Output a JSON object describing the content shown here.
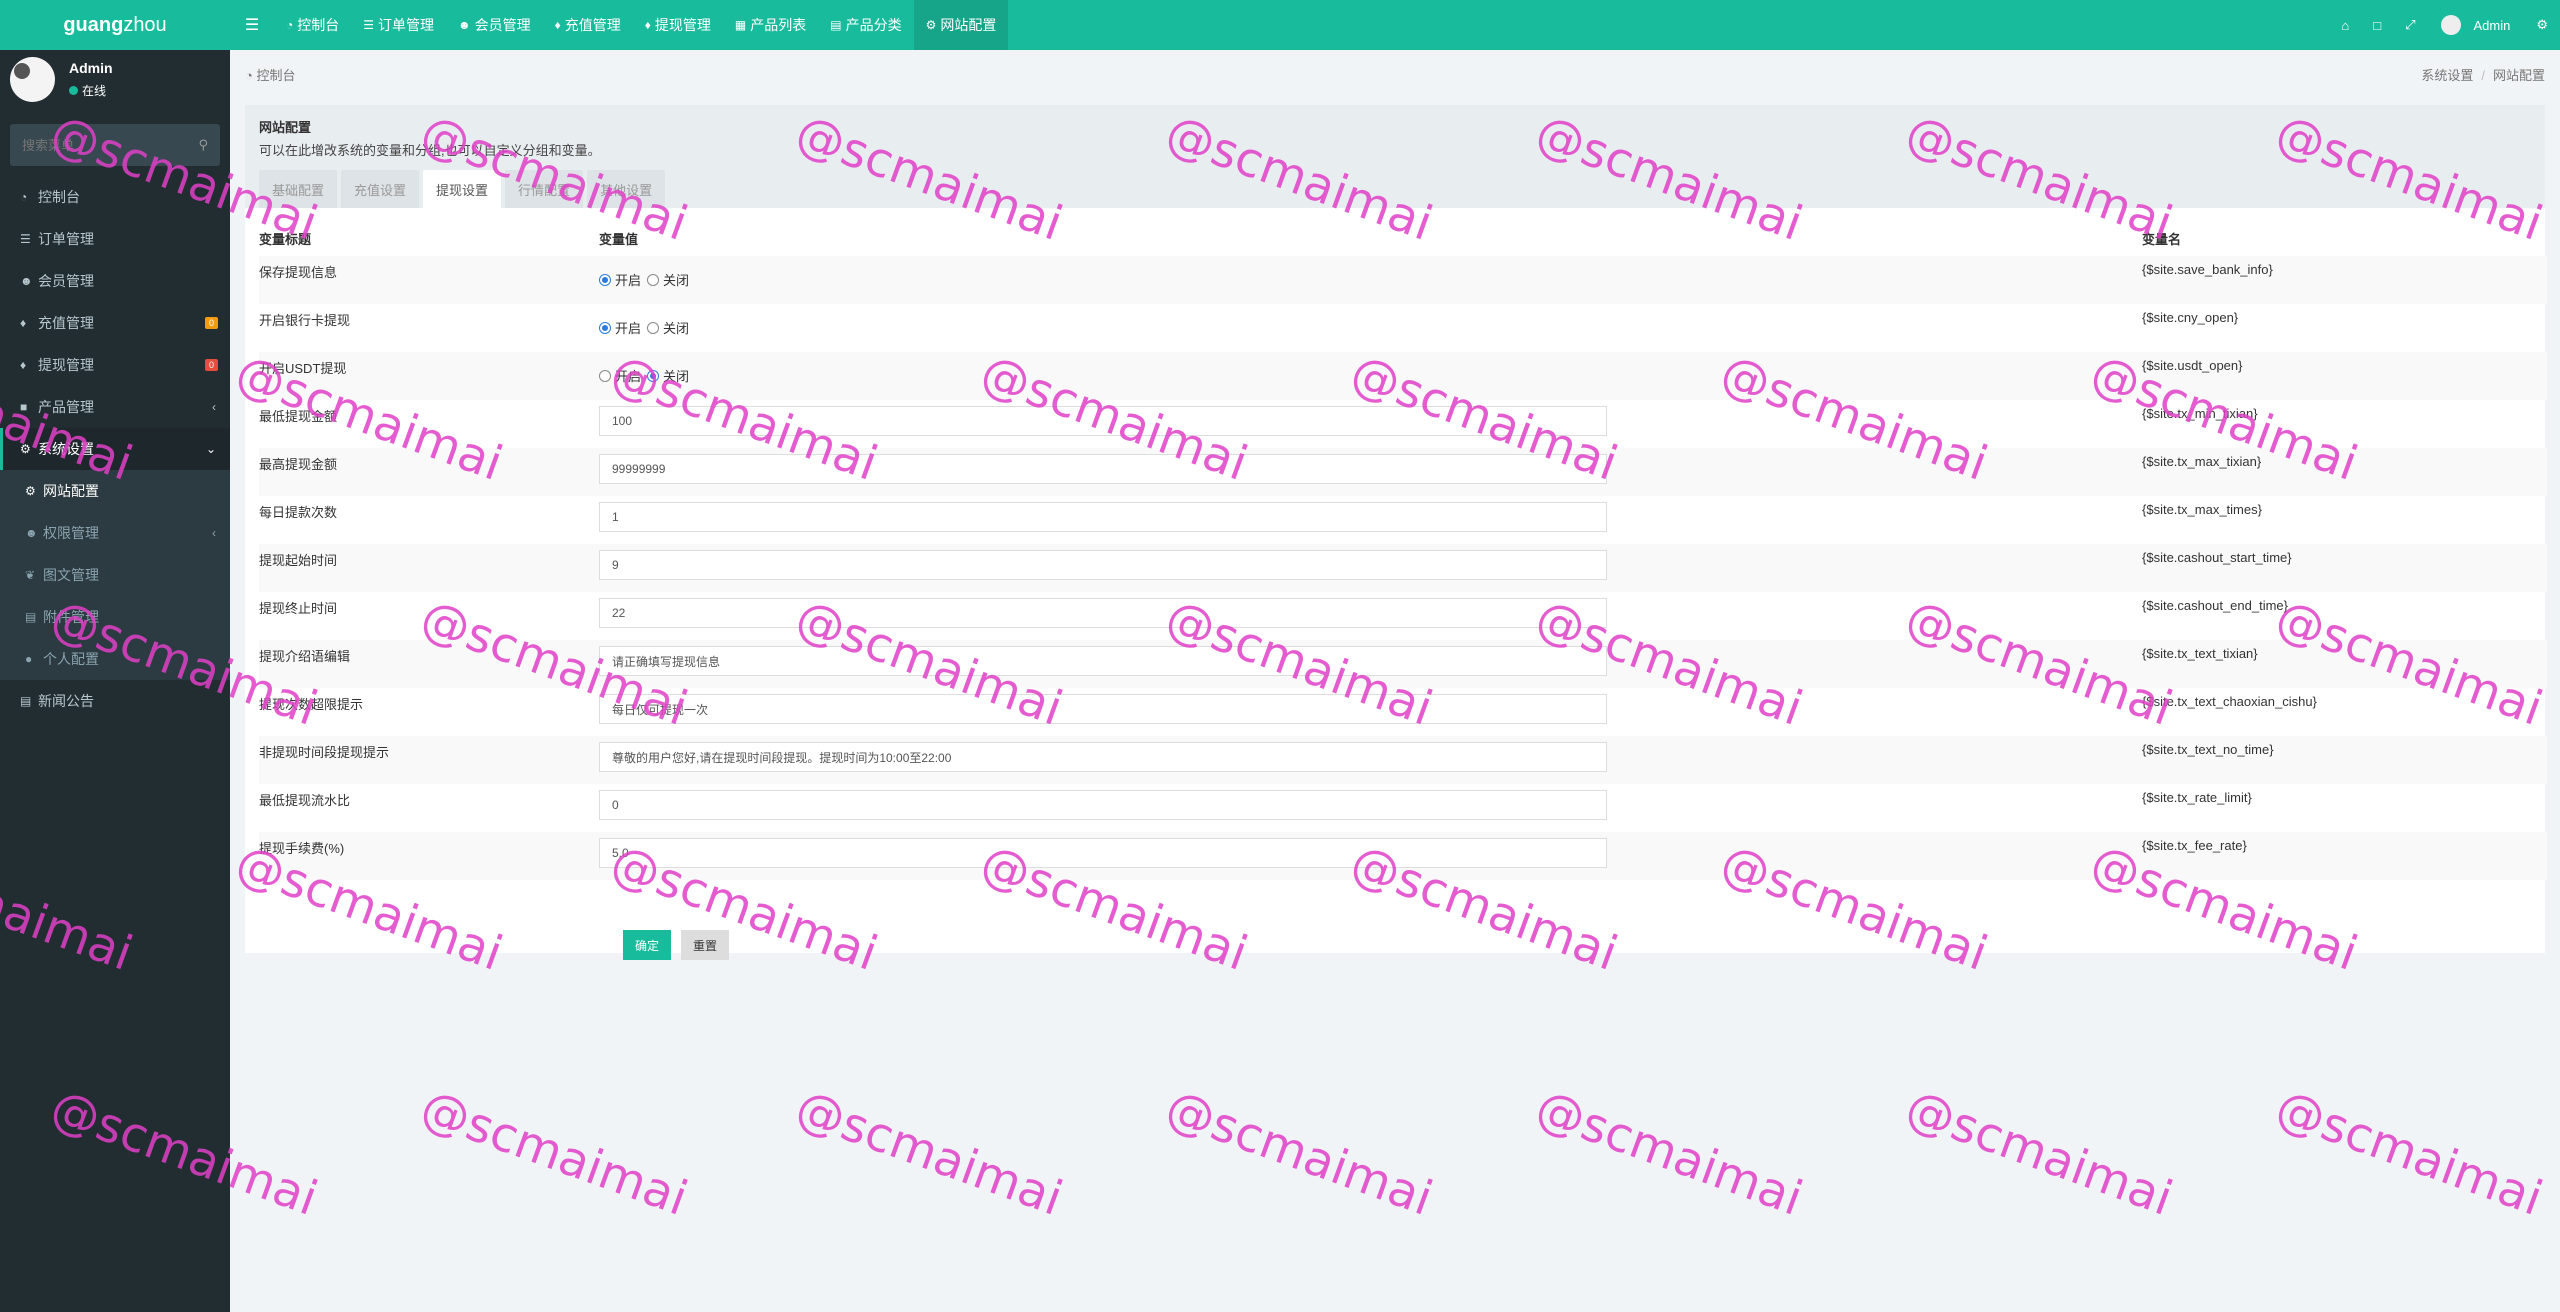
{
  "logo": {
    "bold": "guang",
    "rest": "zhou"
  },
  "user": {
    "name": "Admin",
    "status": "在线"
  },
  "search": {
    "placeholder": "搜索菜单"
  },
  "sidebar": {
    "items": [
      {
        "label": "控制台",
        "icon": "dashboard-icon"
      },
      {
        "label": "订单管理",
        "icon": "list-icon"
      },
      {
        "label": "会员管理",
        "icon": "users-icon"
      },
      {
        "label": "充值管理",
        "icon": "recharge-icon",
        "badge": "0"
      },
      {
        "label": "提现管理",
        "icon": "withdraw-icon",
        "badge": "0"
      },
      {
        "label": "产品管理",
        "icon": "product-icon"
      },
      {
        "label": "系统设置",
        "icon": "settings-icon"
      }
    ],
    "sub": [
      {
        "label": "网站配置",
        "icon": "gear-icon"
      },
      {
        "label": "权限管理",
        "icon": "users-icon"
      },
      {
        "label": "图文管理",
        "icon": "leaf-icon"
      },
      {
        "label": "附件管理",
        "icon": "file-icon"
      },
      {
        "label": "个人配置",
        "icon": "user-icon"
      }
    ],
    "news": {
      "label": "新闻公告",
      "icon": "news-icon"
    }
  },
  "topnav": {
    "tabs": [
      "控制台",
      "订单管理",
      "会员管理",
      "充值管理",
      "提现管理",
      "产品列表",
      "产品分类",
      "网站配置"
    ],
    "user": "Admin"
  },
  "breadcrumb": {
    "left": "控制台",
    "right1": "系统设置",
    "right2": "网站配置"
  },
  "panel": {
    "title": "网站配置",
    "desc": "可以在此增改系统的变量和分组,也可以自定义分组和变量。",
    "tabs": [
      "基础配置",
      "充值设置",
      "提现设置",
      "行情配置",
      "其他设置"
    ]
  },
  "table": {
    "headers": [
      "变量标题",
      "变量值",
      "变量名"
    ],
    "rows": [
      {
        "title": "保存提现信息",
        "type": "radio",
        "on": "开启",
        "off": "关闭",
        "selected": "on",
        "name": "{$site.save_bank_info}"
      },
      {
        "title": "开启银行卡提现",
        "type": "radio",
        "on": "开启",
        "off": "关闭",
        "selected": "on",
        "name": "{$site.cny_open}"
      },
      {
        "title": "开启USDT提现",
        "type": "radio",
        "on": "开启",
        "off": "关闭",
        "selected": "off",
        "name": "{$site.usdt_open}"
      },
      {
        "title": "最低提现金额",
        "type": "input",
        "value": "100",
        "name": "{$site.tx_min_tixian}"
      },
      {
        "title": "最高提现金额",
        "type": "input",
        "value": "99999999",
        "name": "{$site.tx_max_tixian}"
      },
      {
        "title": "每日提款次数",
        "type": "input",
        "value": "1",
        "name": "{$site.tx_max_times}"
      },
      {
        "title": "提现起始时间",
        "type": "input",
        "value": "9",
        "name": "{$site.cashout_start_time}"
      },
      {
        "title": "提现终止时间",
        "type": "input",
        "value": "22",
        "name": "{$site.cashout_end_time}"
      },
      {
        "title": "提现介绍语编辑",
        "type": "input",
        "value": "请正确填写提现信息",
        "name": "{$site.tx_text_tixian}"
      },
      {
        "title": "提现次数超限提示",
        "type": "input",
        "value": "每日仅可提现一次",
        "name": "{$site.tx_text_chaoxian_cishu}"
      },
      {
        "title": "非提现时间段提现提示",
        "type": "input",
        "value": "尊敬的用户您好,请在提现时间段提现。提现时间为10:00至22:00",
        "name": "{$site.tx_text_no_time}"
      },
      {
        "title": "最低提现流水比",
        "type": "input",
        "value": "0",
        "name": "{$site.tx_rate_limit}"
      },
      {
        "title": "提现手续费(%)",
        "type": "input",
        "value": "5.0",
        "name": "{$site.tx_fee_rate}"
      }
    ]
  },
  "buttons": {
    "ok": "确定",
    "reset": "重置"
  },
  "watermark": "@scmaimai"
}
